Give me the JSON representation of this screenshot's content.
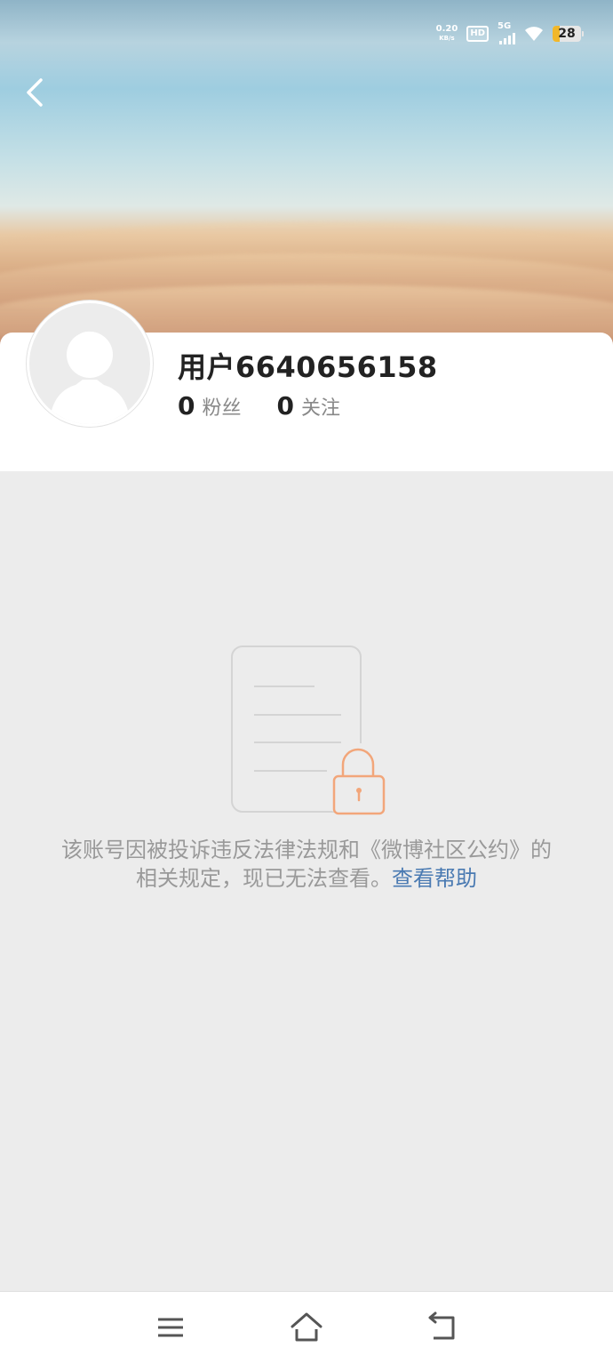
{
  "status_bar": {
    "net_speed_value": "0.20",
    "net_speed_unit": "KB/s",
    "hd_label": "HD",
    "network_label": "5G",
    "battery_level": "28",
    "battery_color": "#f1b72a"
  },
  "header": {
    "back_icon": "chevron-left-icon"
  },
  "profile": {
    "username": "用户6640656158",
    "followers_count": "0",
    "followers_label": "粉丝",
    "following_count": "0",
    "following_label": "关注"
  },
  "empty_state": {
    "illustration_icon": "locked-document-icon",
    "accent_color": "#f2a67a",
    "message": "该账号因被投诉违反法律法规和《微博社区公约》的相关规定，现已无法查看。",
    "help_link": "查看帮助",
    "link_color": "#4a7ab2"
  },
  "nav_bar": {
    "buttons": [
      "menu-icon",
      "home-icon",
      "back-icon"
    ]
  }
}
